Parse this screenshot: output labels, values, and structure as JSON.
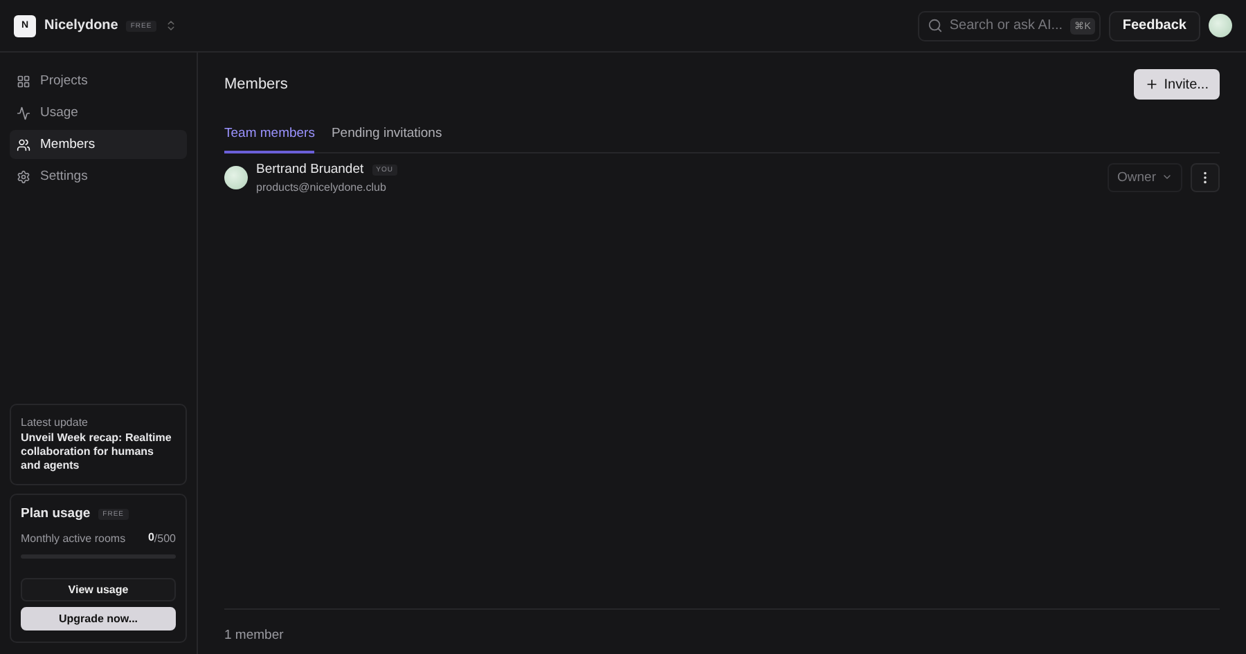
{
  "workspace": {
    "initial": "N",
    "name": "Nicelydone",
    "plan_badge": "FREE"
  },
  "search": {
    "placeholder": "Search or ask AI...",
    "shortcut": "⌘K"
  },
  "feedback_button": "Feedback",
  "sidebar": {
    "items": [
      {
        "label": "Projects",
        "kind": "grid",
        "selected": false
      },
      {
        "label": "Usage",
        "kind": "pulse",
        "selected": false
      },
      {
        "label": "Members",
        "kind": "users",
        "selected": true
      },
      {
        "label": "Settings",
        "kind": "gear",
        "selected": false
      }
    ]
  },
  "latest_update": {
    "heading": "Latest update",
    "text": "Unveil Week recap: Realtime collaboration for humans and agents"
  },
  "plan_usage": {
    "title": "Plan usage",
    "badge": "FREE",
    "metric": "Monthly active rooms",
    "used": "0",
    "limit": "/500",
    "view_button": "View usage",
    "upgrade_button": "Upgrade now..."
  },
  "page": {
    "title": "Members",
    "invite_button": "Invite..."
  },
  "tabs": [
    {
      "label": "Team members",
      "selected": true
    },
    {
      "label": "Pending invitations",
      "selected": false
    }
  ],
  "members": [
    {
      "name": "Bertrand Bruandet",
      "badge": "YOU",
      "email": "products@nicelydone.club",
      "role": "Owner"
    }
  ],
  "footer": "1 member"
}
